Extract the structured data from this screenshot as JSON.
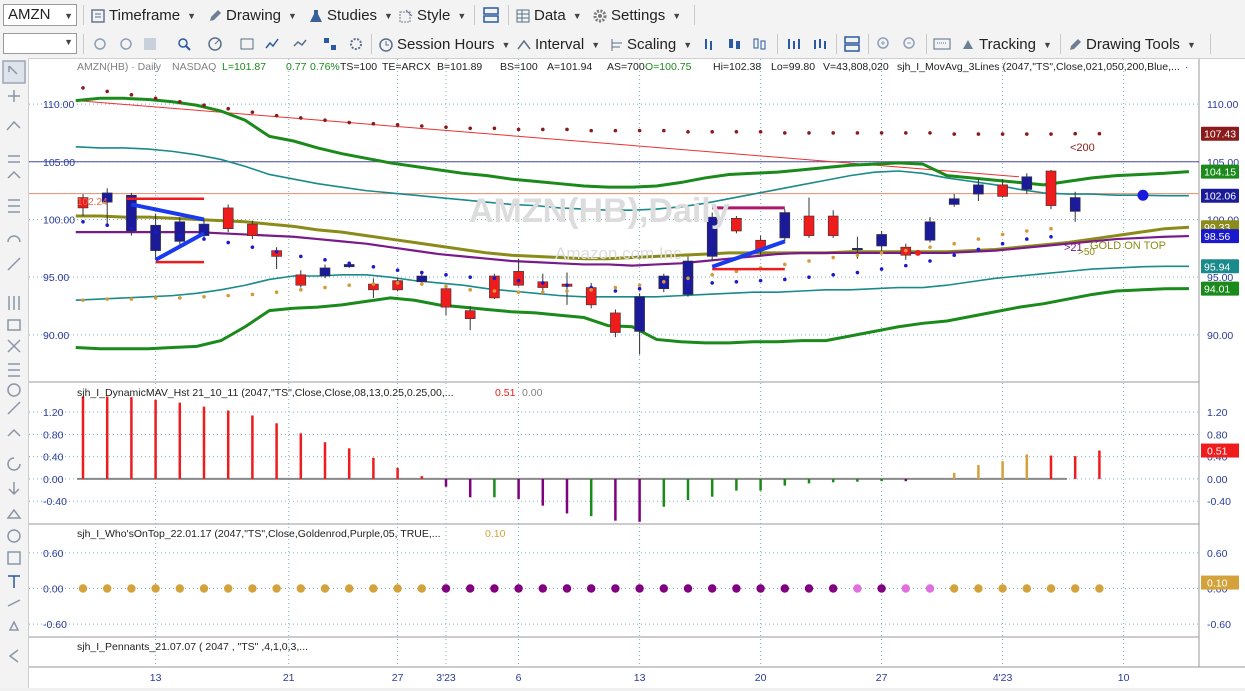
{
  "toolbar1": {
    "symbol": "AMZN",
    "timeframe": "Timeframe",
    "drawing": "Drawing",
    "studies": "Studies",
    "style": "Style",
    "data": "Data",
    "settings": "Settings"
  },
  "toolbar2": {
    "session_hours": "Session Hours",
    "interval": "Interval",
    "scaling": "Scaling",
    "tracking": "Tracking",
    "drawing_tools": "Drawing Tools"
  },
  "colors": {
    "up_candle": "#1b1b9a",
    "down_candle": "#ee1c1c",
    "green_band": "#1a8a1a",
    "teal_band": "#1a8a8a",
    "olive": "#8b8b1a",
    "purple": "#7a1a8a",
    "goldenrod": "#d4a23a",
    "maroon": "#8b1a1a",
    "blue_dots": "#1a1acc"
  },
  "chart_data": [
    {
      "type": "candlestick",
      "header": {
        "symbol": "AMZN(HB) · Daily",
        "exchange": "NASDAQ",
        "last": "L=101.87",
        "change": "0.77",
        "change_pct": "0.76%",
        "ts": "TS=100",
        "te": "TE=ARCX",
        "bid": "B=101.89",
        "bs": "BS=100",
        "ask": "A=101.94",
        "as": "AS=700",
        "open": "O=100.75",
        "high": "Hi=102.38",
        "low": "Lo=99.80",
        "volume": "V=43,808,020",
        "study": "sjh_I_MovAvg_3Lines (2047,\"TS\",Close,021,050,200,Blue,...",
        "more": "·"
      },
      "watermark": "AMZN(HB),Daily",
      "watermark_sub": "Amazon.com Inc",
      "ylim": [
        86,
        112
      ],
      "y_ticks": [
        90,
        95,
        100,
        105,
        110
      ],
      "y_tick_labels": [
        "90.00",
        "95.00",
        "100.00",
        "105.00",
        "110.00"
      ],
      "x_labels": [
        "13",
        "21",
        "27",
        "3'23",
        "6",
        "13",
        "20",
        "27",
        "4'23",
        "10"
      ],
      "x_label_bars": [
        3,
        8.5,
        13,
        15,
        18,
        23,
        28,
        33,
        38,
        43
      ],
      "level_label": "102.24",
      "level": 102.24,
      "hline_blue": 105,
      "labels": {
        "ma200": "<200",
        "ma21": ">21",
        "ma50": ">50",
        "gold": "GOLD ON TOP"
      },
      "price_badges": [
        {
          "value": "107.43",
          "y": 107.43,
          "color": "#8b1a1a"
        },
        {
          "value": "104.15",
          "y": 104.15,
          "color": "#1a8a1a"
        },
        {
          "value": "102.06",
          "y": 102.06,
          "color": "#1b1b9a"
        },
        {
          "value": "99.33",
          "y": 99.33,
          "color": "#8b8b1a"
        },
        {
          "value": "98.56",
          "y": 98.56,
          "color": "#1a1acc"
        },
        {
          "value": "95.94",
          "y": 95.94,
          "color": "#1a8a8a"
        },
        {
          "value": "94.01",
          "y": 94.01,
          "color": "#1a8a1a"
        }
      ],
      "candles": [
        [
          101.9,
          101.0,
          102.2,
          100.3
        ],
        [
          101.5,
          102.3,
          102.7,
          99.4
        ],
        [
          99.0,
          102.1,
          102.3,
          98.6
        ],
        [
          97.3,
          99.5,
          100.5,
          96.5
        ],
        [
          98.1,
          99.8,
          100.2,
          97.6
        ],
        [
          98.6,
          99.6,
          100.0,
          98.3
        ],
        [
          101.0,
          99.2,
          101.3,
          98.9
        ],
        [
          99.6,
          98.6,
          99.9,
          98.3
        ],
        [
          97.3,
          96.8,
          97.6,
          95.7
        ],
        [
          95.2,
          94.3,
          95.6,
          94.1
        ],
        [
          95.1,
          95.8,
          96.1,
          94.9
        ],
        [
          95.9,
          96.1,
          96.3,
          95.8
        ],
        [
          94.4,
          93.9,
          94.9,
          93.2
        ],
        [
          94.7,
          93.9,
          94.9,
          93.8
        ],
        [
          94.6,
          95.1,
          95.5,
          94.3
        ],
        [
          94.0,
          92.4,
          94.1,
          91.7
        ],
        [
          92.1,
          91.4,
          92.5,
          90.4
        ],
        [
          95.1,
          93.2,
          95.3,
          93.1
        ],
        [
          95.5,
          94.3,
          96.6,
          94.2
        ],
        [
          94.6,
          94.1,
          95.3,
          93.6
        ],
        [
          94.4,
          94.2,
          95.4,
          92.6
        ],
        [
          94.1,
          92.6,
          94.5,
          92.3
        ],
        [
          91.9,
          90.2,
          92.2,
          89.8
        ],
        [
          90.3,
          93.3,
          93.6,
          88.3
        ],
        [
          94.0,
          95.1,
          95.3,
          93.7
        ],
        [
          93.5,
          96.4,
          96.8,
          93.3
        ],
        [
          96.8,
          100.2,
          100.6,
          96.5
        ],
        [
          100.1,
          99.0,
          100.3,
          98.8
        ],
        [
          98.2,
          97.4,
          98.6,
          96.9
        ],
        [
          98.4,
          100.6,
          100.9,
          98.1
        ],
        [
          100.3,
          98.6,
          101.9,
          98.4
        ],
        [
          100.3,
          98.6,
          100.8,
          98.4
        ],
        [
          97.5,
          97.5,
          98.5,
          96.6
        ],
        [
          97.7,
          98.7,
          99.0,
          97.2
        ],
        [
          97.6,
          96.9,
          97.9,
          96.5
        ],
        [
          98.2,
          99.8,
          100.2,
          98.0
        ],
        [
          101.3,
          101.8,
          102.2,
          101.1
        ],
        [
          102.2,
          103.0,
          103.5,
          101.6
        ],
        [
          103.0,
          102.0,
          103.5,
          101.9
        ],
        [
          102.6,
          103.7,
          104.0,
          102.2
        ],
        [
          104.2,
          101.2,
          104.3,
          100.9
        ],
        [
          100.7,
          101.9,
          102.4,
          99.8
        ]
      ],
      "series": [
        {
          "name": "green_upper",
          "values": [
            110.3,
            110.5,
            110.5,
            110.4,
            110.2,
            109.9,
            109.4,
            108.6,
            107.2,
            106.8,
            106.2,
            105.7,
            105.3,
            104.9,
            104.6,
            104.3,
            104.0,
            103.8,
            103.5,
            103.3,
            103.1,
            102.9,
            102.8,
            102.8,
            102.9,
            103.2,
            103.6,
            103.9,
            104.0,
            104.1,
            104.3,
            104.5,
            104.7,
            104.8,
            104.9,
            104.8,
            103.8,
            103.6,
            103.4,
            103.2,
            103.0,
            103.3,
            103.6,
            103.8,
            103.9,
            104.0,
            104.15
          ]
        },
        {
          "name": "teal_upper",
          "values": [
            106.3,
            106.2,
            106.2,
            106.1,
            105.9,
            105.6,
            105.2,
            104.6,
            103.9,
            103.5,
            103.1,
            102.8,
            102.5,
            102.3,
            102.1,
            101.9,
            101.7,
            101.5,
            101.3,
            101.2,
            101.0,
            100.9,
            100.8,
            100.8,
            100.9,
            101.1,
            101.4,
            101.8,
            102.2,
            102.6,
            103.0,
            103.4,
            103.8,
            104.1,
            104.2,
            104.0,
            103.6,
            103.3,
            103.0,
            102.6,
            102.3,
            102.2,
            102.2,
            102.1,
            102.1,
            102.06,
            102.06
          ]
        },
        {
          "name": "olive",
          "values": [
            100.3,
            100.3,
            100.2,
            100.2,
            100.1,
            100.0,
            99.9,
            99.8,
            99.6,
            99.4,
            99.1,
            98.9,
            98.6,
            98.3,
            98.0,
            97.7,
            97.4,
            97.1,
            96.9,
            96.8,
            96.7,
            96.6,
            96.6,
            96.7,
            96.8,
            96.9,
            97.0,
            97.1,
            97.1,
            97.1,
            97.1,
            97.1,
            97.2,
            97.2,
            97.2,
            97.2,
            97.2,
            97.3,
            97.4,
            97.6,
            97.8,
            98.0,
            98.3,
            98.6,
            98.9,
            99.2,
            99.33
          ]
        },
        {
          "name": "purple",
          "values": [
            98.9,
            98.9,
            98.9,
            98.9,
            98.9,
            98.9,
            98.8,
            98.7,
            98.6,
            98.5,
            98.3,
            98.1,
            97.9,
            97.6,
            97.3,
            97.0,
            96.8,
            96.6,
            96.4,
            96.3,
            96.2,
            96.1,
            96.1,
            96.0,
            96.1,
            96.2,
            96.4,
            96.6,
            96.8,
            97.0,
            97.1,
            97.1,
            97.1,
            97.1,
            97.1,
            97.1,
            97.1,
            97.2,
            97.3,
            97.5,
            97.7,
            97.9,
            98.1,
            98.3,
            98.4,
            98.5,
            98.56
          ]
        },
        {
          "name": "teal_lower",
          "values": [
            93.0,
            93.1,
            93.2,
            93.3,
            93.4,
            93.6,
            93.9,
            94.3,
            94.8,
            95.1,
            95.1,
            95.2,
            95.2,
            95.0,
            94.7,
            94.5,
            94.3,
            94.0,
            93.8,
            93.6,
            93.4,
            93.3,
            93.3,
            93.3,
            93.3,
            93.4,
            93.5,
            93.6,
            93.7,
            93.7,
            93.8,
            93.9,
            93.9,
            94.0,
            94.1,
            94.1,
            94.3,
            94.6,
            94.9,
            95.1,
            95.3,
            95.5,
            95.7,
            95.8,
            95.9,
            95.94,
            95.94
          ]
        },
        {
          "name": "green_lower",
          "values": [
            88.9,
            88.8,
            88.8,
            88.8,
            88.9,
            89.0,
            89.5,
            90.7,
            92.1,
            92.3,
            92.4,
            92.6,
            92.9,
            93.2,
            93.0,
            92.6,
            92.4,
            92.2,
            92.0,
            91.9,
            91.7,
            91.5,
            90.8,
            90.7,
            89.6,
            89.4,
            89.3,
            89.3,
            89.4,
            89.4,
            89.5,
            89.5,
            89.9,
            90.3,
            90.7,
            91.0,
            91.2,
            91.6,
            92.0,
            92.4,
            92.7,
            93.1,
            93.5,
            93.8,
            93.9,
            94.0,
            94.01
          ]
        },
        {
          "name": "ma200_dots",
          "values": [
            111.4,
            111.1,
            110.8,
            110.5,
            110.2,
            109.9,
            109.6,
            109.3,
            109.0,
            108.8,
            108.6,
            108.4,
            108.3,
            108.2,
            108.1,
            108.0,
            107.9,
            107.9,
            107.8,
            107.8,
            107.8,
            107.7,
            107.7,
            107.7,
            107.7,
            107.6,
            107.6,
            107.6,
            107.6,
            107.5,
            107.5,
            107.5,
            107.5,
            107.5,
            107.5,
            107.5,
            107.4,
            107.4,
            107.4,
            107.4,
            107.4,
            107.43,
            107.43
          ]
        },
        {
          "name": "blue_dots",
          "values": [
            99.8,
            99.5,
            99.2,
            98.9,
            98.6,
            98.3,
            98.0,
            97.6,
            97.2,
            96.8,
            96.5,
            96.2,
            95.9,
            95.6,
            95.4,
            95.2,
            95.0,
            94.9,
            94.7,
            94.5,
            94.3,
            94.1,
            93.8,
            94.0,
            94.3,
            94.5,
            94.5,
            94.6,
            94.7,
            94.8,
            95.0,
            95.2,
            95.4,
            95.7,
            96.0,
            96.4,
            96.9,
            97.4,
            97.9,
            98.3,
            98.5
          ]
        },
        {
          "name": "gold_dots",
          "values": [
            93.0,
            93.1,
            93.1,
            93.2,
            93.2,
            93.3,
            93.4,
            93.5,
            93.7,
            93.9,
            94.1,
            94.3,
            94.4,
            94.5,
            94.4,
            94.2,
            93.9,
            93.8,
            93.7,
            93.7,
            93.8,
            93.9,
            94.1,
            94.3,
            94.6,
            94.9,
            95.2,
            95.5,
            95.8,
            96.1,
            96.4,
            96.7,
            96.9,
            97.1,
            97.3,
            97.6,
            97.9,
            98.3,
            98.7,
            99.0,
            99.2
          ]
        },
        {
          "name": "pennant_blue",
          "values": []
        }
      ]
    },
    {
      "type": "bar",
      "title": "sjh_I_DynamicMAV_Hst 21_10_11 (2047,\"TS\",Close,Close,08,13,0.25,0.25,00,...",
      "value_label": "0.51",
      "value_label2": "0.00",
      "ylim": [
        -0.72,
        1.4
      ],
      "y_ticks": [
        1.2,
        0.8,
        0.4,
        0.0,
        -0.4
      ],
      "y_tick_labels": [
        "1.20",
        "0.80",
        "0.40",
        "0.00",
        "-0.40"
      ],
      "badge": "0.51",
      "values": [
        1.48,
        1.48,
        1.47,
        1.42,
        1.37,
        1.3,
        1.23,
        1.14,
        1.0,
        0.82,
        0.66,
        0.55,
        0.38,
        0.2,
        0.05,
        -0.14,
        -0.33,
        -0.33,
        -0.36,
        -0.48,
        -0.62,
        -0.67,
        -0.75,
        -0.77,
        -0.5,
        -0.38,
        -0.32,
        -0.21,
        -0.21,
        -0.12,
        -0.08,
        -0.06,
        -0.05,
        -0.04,
        -0.04,
        0.0,
        0.11,
        0.25,
        0.32,
        0.44,
        0.42,
        0.41,
        0.51
      ],
      "bar_colors": [
        "#ee1c1c",
        "#ee1c1c",
        "#ee1c1c",
        "#ee1c1c",
        "#ee1c1c",
        "#ee1c1c",
        "#ee1c1c",
        "#ee1c1c",
        "#ee1c1c",
        "#ee1c1c",
        "#ee1c1c",
        "#ee1c1c",
        "#ee1c1c",
        "#ee1c1c",
        "#ee1c1c",
        "#800080",
        "#800080",
        "#1a8a1a",
        "#800080",
        "#800080",
        "#800080",
        "#1a8a1a",
        "#800080",
        "#800080",
        "#1a8a1a",
        "#1a8a1a",
        "#1a8a1a",
        "#1a8a1a",
        "#1a8a1a",
        "#1a8a1a",
        "#1a8a1a",
        "#1a8a1a",
        "#1a8a1a",
        "#1a8a1a",
        "#800080",
        "#d4a23a",
        "#d4a23a",
        "#d4a23a",
        "#d4a23a",
        "#d4a23a",
        "#ee1c1c",
        "#ee1c1c",
        "#ee1c1c"
      ]
    },
    {
      "type": "scatter",
      "title": "sjh_I_Who'sOnTop_22.01.17 (2047,\"TS\",Close,Goldenrod,Purple,05, TRUE,...",
      "value_label": "0.10",
      "ylim": [
        -0.75,
        0.75
      ],
      "y_ticks": [
        0.6,
        0.0,
        -0.6
      ],
      "y_tick_labels": [
        "0.60",
        "0.00",
        "-0.60"
      ],
      "badge": "0.10",
      "dot_colors": [
        "#d4a23a",
        "#d4a23a",
        "#d4a23a",
        "#d4a23a",
        "#d4a23a",
        "#d4a23a",
        "#d4a23a",
        "#d4a23a",
        "#d4a23a",
        "#d4a23a",
        "#d4a23a",
        "#d4a23a",
        "#d4a23a",
        "#d4a23a",
        "#d4a23a",
        "#800080",
        "#800080",
        "#800080",
        "#800080",
        "#800080",
        "#800080",
        "#800080",
        "#800080",
        "#800080",
        "#800080",
        "#800080",
        "#800080",
        "#800080",
        "#800080",
        "#800080",
        "#800080",
        "#800080",
        "#e070e0",
        "#800080",
        "#e070e0",
        "#e070e0",
        "#d4a23a",
        "#d4a23a",
        "#d4a23a",
        "#d4a23a",
        "#d4a23a",
        "#d4a23a",
        "#d4a23a"
      ]
    },
    {
      "type": "table",
      "title": "sjh_I_Pennants_21.07.07 ( 2047 , \"TS\" ,4,1,0,3,..."
    }
  ]
}
